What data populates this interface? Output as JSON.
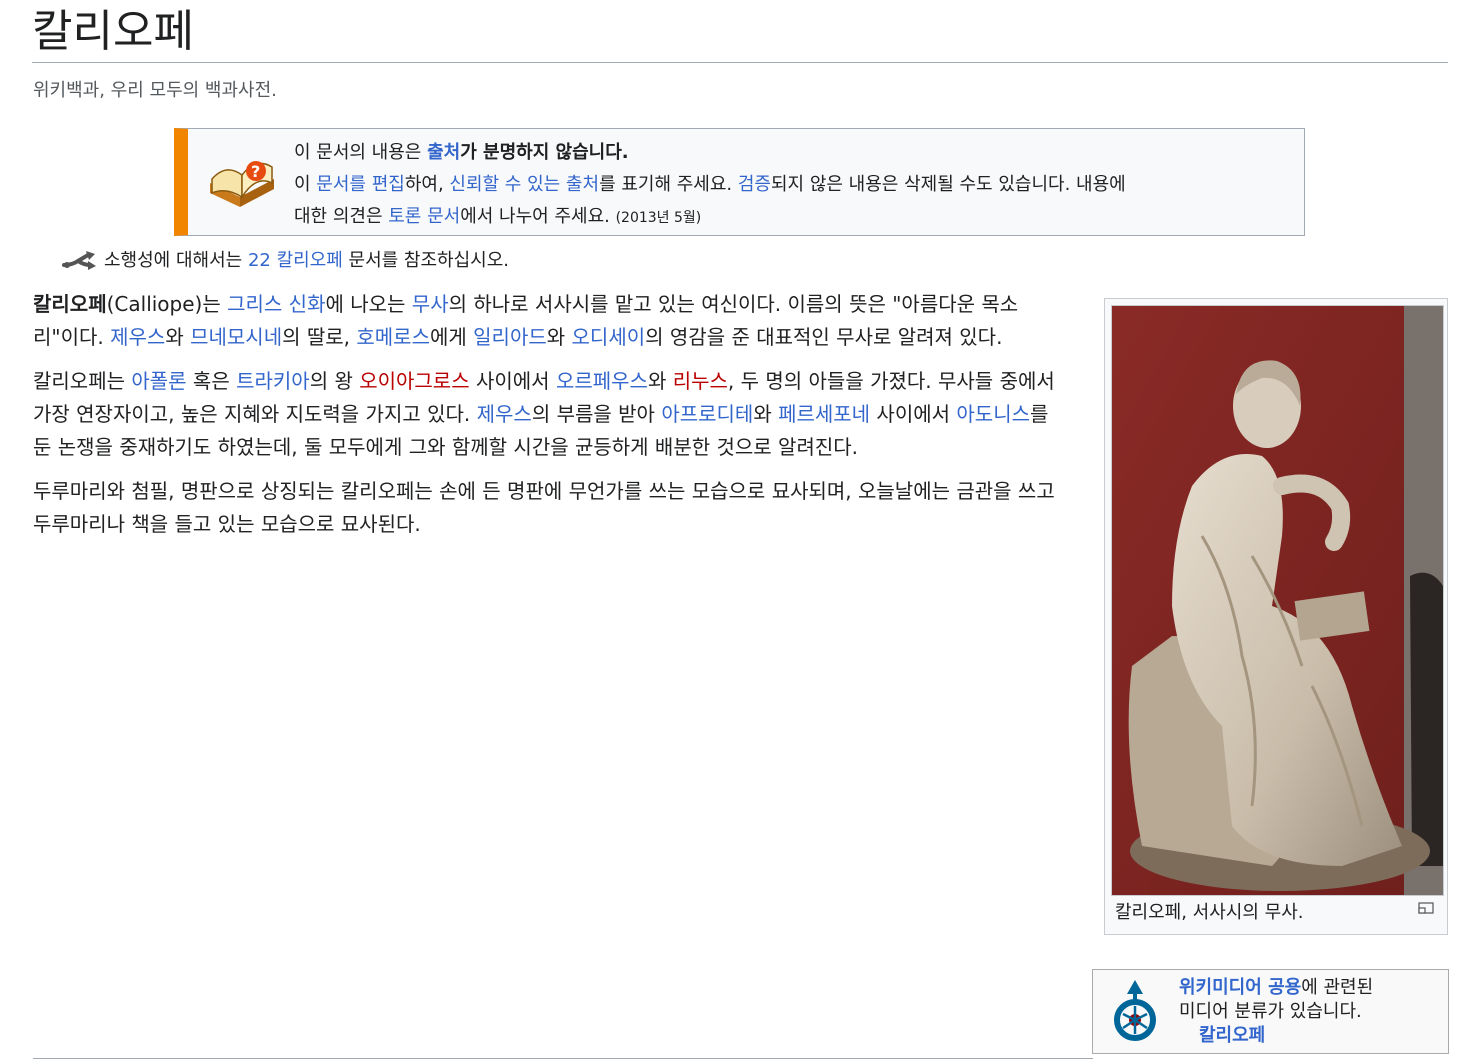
{
  "page": {
    "title": "칼리오페",
    "subtitle": "위키백과, 우리 모두의 백과사전."
  },
  "ambox": {
    "line1_pre": "이 문서의 내용은 ",
    "line1_link": "출처",
    "line1_post": "가 분명하지 않습니다.",
    "line2_a": "이 ",
    "line2_link1": "문서를 편집",
    "line2_b": "하여, ",
    "line2_link2": "신뢰할 수 있는 출처",
    "line2_c": "를 표기해 주세요. ",
    "line2_link3": "검증",
    "line2_d": "되지 않은 내용은 삭제될 수도 있습니다. 내용에",
    "line3_a": "대한 의견은 ",
    "line3_link": "토론 문서",
    "line3_b": "에서 나누어 주세요. ",
    "date": "(2013년 5월)"
  },
  "hatnote": {
    "pre": "소행성에 대해서는 ",
    "link": "22 칼리오페",
    "post": " 문서를 참조하십시오."
  },
  "p1": {
    "bold": "칼리오페",
    "a": "(Calliope)는 ",
    "l1": "그리스 신화",
    "b": "에 나오는 ",
    "l2": "무사",
    "c": "의 하나로 서사시를 맡고 있는 여신이다. 이름의 뜻은 \"아름다운 목소리\"이다. ",
    "l3": "제우스",
    "d": "와 ",
    "l4": "므네모시네",
    "e": "의 딸로, ",
    "l5": "호메로스",
    "f": "에게 ",
    "l6": "일리아드",
    "g": "와 ",
    "l7": "오디세이",
    "h": "의 영감을 준 대표적인 무사로 알려져 있다."
  },
  "p2": {
    "a": "칼리오페는 ",
    "l1": "아폴론",
    "b": " 혹은 ",
    "l2": "트라키아",
    "c": "의 왕 ",
    "r1": "오이아그로스",
    "d": " 사이에서 ",
    "l3": "오르페우스",
    "e": "와 ",
    "r2": "리누스",
    "f": ", 두 명의 아들을 가졌다. 무사들 중에서 가장 연장자이고, 높은 지혜와 지도력을 가지고 있다. ",
    "l4": "제우스",
    "g": "의 부름을 받아 ",
    "l5": "아프로디테",
    "h": "와 ",
    "l6": "페르세포네",
    "i": " 사이에서 ",
    "l7": "아도니스",
    "j": "를 둔 논쟁을 중재하기도 하였는데, 둘 모두에게 그와 함께할 시간을 균등하게 배분한 것으로 알려진다."
  },
  "p3": {
    "text": "두루마리와 첨필, 명판으로 상징되는 칼리오페는 손에 든 명판에 무언가를 쓰는 모습으로 묘사되며, 오늘날에는 금관을 쓰고 두루마리나 책을 들고 있는 모습으로 묘사된다."
  },
  "thumb": {
    "caption": "칼리오페, 서사시의 무사."
  },
  "commons": {
    "link": "위키미디어 공용",
    "text1": "에 관련된",
    "text2": "미디어 분류가 있습니다.",
    "category": "칼리오페"
  },
  "colors": {
    "link": "#3366cc",
    "redlink": "#ba0000",
    "ambox_accent": "#f28500"
  },
  "icons": [
    "book-question-icon",
    "disambiguation-icon",
    "magnify-icon",
    "commons-logo-icon"
  ]
}
